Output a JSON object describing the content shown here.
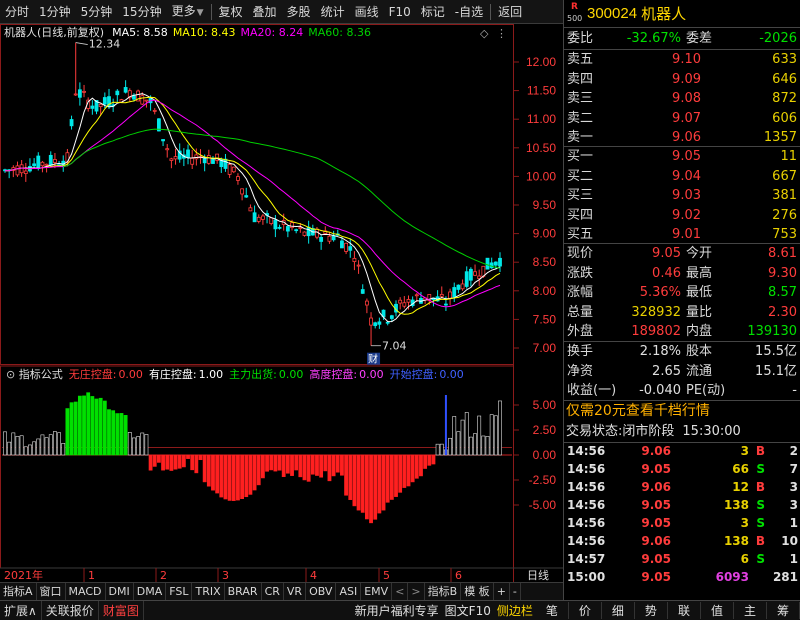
{
  "toolbar": {
    "items": [
      "分时",
      "1分钟",
      "5分钟",
      "15分钟",
      "更多",
      "复权",
      "叠加",
      "多股",
      "统计",
      "画线",
      "F10",
      "标记",
      "-自选",
      "返回"
    ]
  },
  "main_chart": {
    "stock_title": "机器人(日线,前复权)",
    "ma5": "MA5: 8.58",
    "ma10": "MA10: 8.43",
    "ma20": "MA20: 8.24",
    "ma60": "MA60: 8.36",
    "high_label": "12.34",
    "low_label": "7.04",
    "cai_label": "财",
    "price_ticks": [
      "12.00",
      "11.50",
      "11.00",
      "10.50",
      "10.00",
      "9.50",
      "9.00",
      "8.50",
      "8.00",
      "7.50",
      "7.00"
    ]
  },
  "indicator": {
    "name": "指标公式",
    "wu_label": "无庄控盘:",
    "wu_val": "0.00",
    "you_label": "有庄控盘:",
    "you_val": "1.00",
    "zl_label": "主力出货:",
    "zl_val": "0.00",
    "gd_label": "高度控盘:",
    "gd_val": "0.00",
    "ks_label": "开始控盘:",
    "ks_val": "0.00",
    "ticks": [
      "5.00",
      "2.50",
      "0.00",
      "-2.50",
      "-5.00"
    ]
  },
  "xaxis": {
    "year": "2021年",
    "months": [
      "1",
      "2",
      "3",
      "4",
      "5",
      "6"
    ],
    "period": "日线"
  },
  "tabs": [
    "指标A",
    "窗口",
    "MACD",
    "DMI",
    "DMA",
    "FSL",
    "TRIX",
    "BRAR",
    "CR",
    "VR",
    "OBV",
    "ASI",
    "EMV"
  ],
  "tabs_right": [
    "指标B",
    "模 板",
    "+",
    "-"
  ],
  "quote": {
    "badge_r": "R",
    "badge_n": "500",
    "code": "300024",
    "name": "机器人",
    "webi_label": "委比",
    "webi": "-32.67%",
    "weicha_label": "委差",
    "weicha": "-2026",
    "asks": [
      {
        "label": "卖五",
        "price": "9.10",
        "vol": "633"
      },
      {
        "label": "卖四",
        "price": "9.09",
        "vol": "646"
      },
      {
        "label": "卖三",
        "price": "9.08",
        "vol": "872"
      },
      {
        "label": "卖二",
        "price": "9.07",
        "vol": "606"
      },
      {
        "label": "卖一",
        "price": "9.06",
        "vol": "1357"
      }
    ],
    "bids": [
      {
        "label": "买一",
        "price": "9.05",
        "vol": "11"
      },
      {
        "label": "买二",
        "price": "9.04",
        "vol": "667"
      },
      {
        "label": "买三",
        "price": "9.03",
        "vol": "381"
      },
      {
        "label": "买四",
        "price": "9.02",
        "vol": "276"
      },
      {
        "label": "买五",
        "price": "9.01",
        "vol": "753"
      }
    ],
    "stats": [
      {
        "l1": "现价",
        "v1": "9.05",
        "c1": "red",
        "l2": "今开",
        "v2": "8.61",
        "c2": "red"
      },
      {
        "l1": "涨跌",
        "v1": "0.46",
        "c1": "red",
        "l2": "最高",
        "v2": "9.30",
        "c2": "red"
      },
      {
        "l1": "涨幅",
        "v1": "5.36%",
        "c1": "red",
        "l2": "最低",
        "v2": "8.57",
        "c2": "grn"
      },
      {
        "l1": "总量",
        "v1": "328932",
        "c1": "yel",
        "l2": "量比",
        "v2": "2.30",
        "c2": "red"
      },
      {
        "l1": "外盘",
        "v1": "189802",
        "c1": "red",
        "l2": "内盘",
        "v2": "139130",
        "c2": "grn"
      }
    ],
    "stats2": [
      {
        "l1": "换手",
        "v1": "2.18%",
        "l2": "股本",
        "v2": "15.5亿"
      },
      {
        "l1": "净资",
        "v1": "2.65",
        "l2": "流通",
        "v2": "15.1亿"
      },
      {
        "l1": "收益(一)",
        "v1": "-0.040",
        "l2": "PE(动)",
        "v2": "-"
      }
    ],
    "banner": "仅需20元查看千档行情",
    "status_label": "交易状态:",
    "status_val": "闭市阶段",
    "status_time": "15:30:00",
    "ticks": [
      {
        "t": "14:56",
        "p": "9.06",
        "v": "3",
        "d": "B",
        "n": "2",
        "vc": "yel",
        "dc": "red"
      },
      {
        "t": "14:56",
        "p": "9.05",
        "v": "66",
        "d": "S",
        "n": "7",
        "vc": "yel",
        "dc": "grn"
      },
      {
        "t": "14:56",
        "p": "9.06",
        "v": "12",
        "d": "B",
        "n": "3",
        "vc": "yel",
        "dc": "red"
      },
      {
        "t": "14:56",
        "p": "9.05",
        "v": "138",
        "d": "S",
        "n": "3",
        "vc": "yel",
        "dc": "grn"
      },
      {
        "t": "14:56",
        "p": "9.05",
        "v": "3",
        "d": "S",
        "n": "1",
        "vc": "yel",
        "dc": "grn"
      },
      {
        "t": "14:56",
        "p": "9.06",
        "v": "138",
        "d": "B",
        "n": "10",
        "vc": "yel",
        "dc": "red"
      },
      {
        "t": "14:57",
        "p": "9.05",
        "v": "6",
        "d": "S",
        "n": "1",
        "vc": "yel",
        "dc": "grn"
      },
      {
        "t": "15:00",
        "p": "9.05",
        "v": "6093",
        "d": "",
        "n": "281",
        "vc": "mag",
        "dc": "wht"
      }
    ]
  },
  "bottom": {
    "items": [
      "扩展∧",
      "关联报价",
      "财富图"
    ],
    "promo": "新用户福利专享",
    "promo2": "图文F10",
    "side": "侧边栏",
    "right": [
      "笔",
      "价",
      "细",
      "势",
      "联",
      "值",
      "主",
      "筹"
    ]
  },
  "colors": {
    "up": "#ff3c3c",
    "down": "#00e000",
    "ma5": "#ffffff",
    "ma10": "#ffff00",
    "ma20": "#ff00ff",
    "ma60": "#00d000"
  }
}
